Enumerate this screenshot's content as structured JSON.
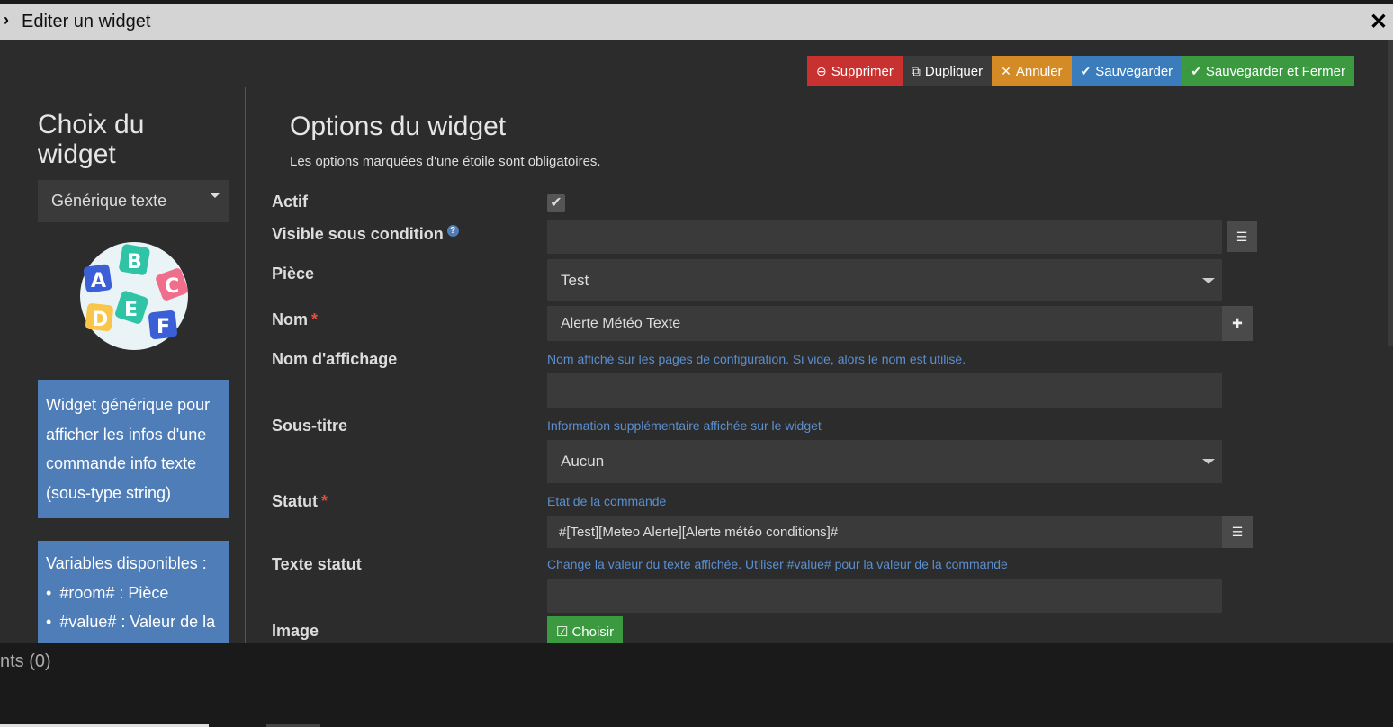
{
  "window": {
    "title": "Editer un widget"
  },
  "toolbar": {
    "delete_label": "Supprimer",
    "duplicate_label": "Dupliquer",
    "cancel_label": "Annuler",
    "save_label": "Sauvegarder",
    "save_close_label": "Sauvegarder et Fermer"
  },
  "sidebar": {
    "title": "Choix du widget",
    "select_value": "Générique texte",
    "description": "Widget générique pour afficher les infos d'une commande info texte (sous-type string)",
    "variables_title": "Variables disponibles :",
    "variables": [
      "#room# : Pièce",
      "#value# : Valeur de la"
    ]
  },
  "main": {
    "title": "Options du widget",
    "subtitle": "Les options marquées d'une étoile sont obligatoires.",
    "fields": {
      "actif_label": "Actif",
      "visible_label": "Visible sous condition",
      "piece_label": "Pièce",
      "piece_value": "Test",
      "nom_label": "Nom",
      "nom_value": "Alerte Météo Texte",
      "nom_affichage_label": "Nom d'affichage",
      "nom_affichage_help": "Nom affiché sur les pages de configuration. Si vide, alors le nom est utilisé.",
      "sous_titre_label": "Sous-titre",
      "sous_titre_help": "Information supplémentaire affichée sur le widget",
      "sous_titre_value": "Aucun",
      "statut_label": "Statut",
      "statut_help": "Etat de la commande",
      "statut_value": "#[Test][Meteo Alerte][Alerte météo conditions]#",
      "texte_statut_label": "Texte statut",
      "texte_statut_help": "Change la valeur du texte affichée. Utiliser #value# pour la valeur de la commande",
      "image_label": "Image",
      "choose_label": "Choisir"
    }
  },
  "bottom": {
    "text": "nts (0)"
  },
  "logo_letters": [
    "A",
    "B",
    "C",
    "D",
    "E",
    "F"
  ]
}
